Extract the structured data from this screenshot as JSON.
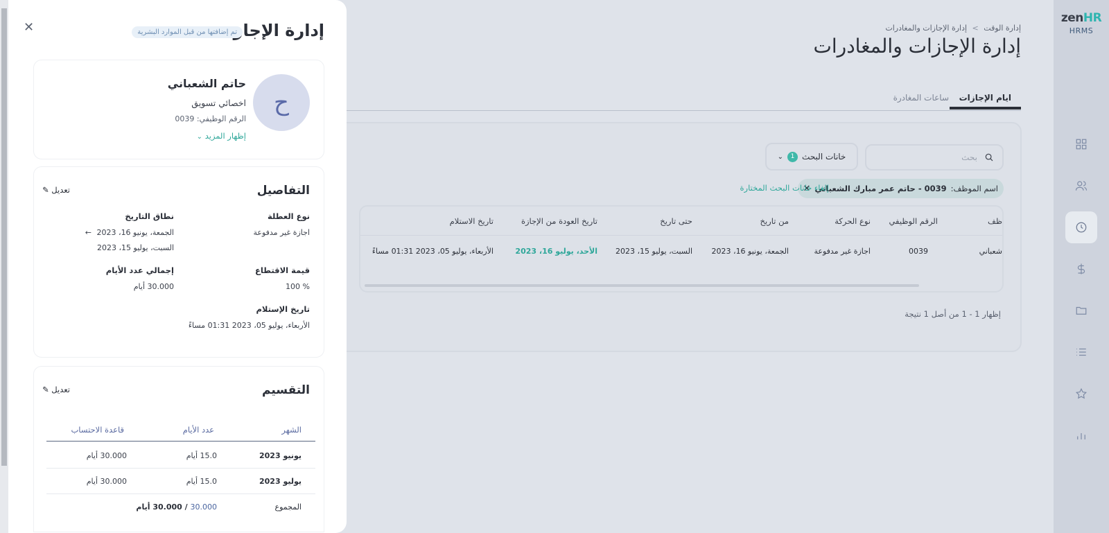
{
  "brand": {
    "logo_a": "zen",
    "logo_b": "HR",
    "sub": "HRMS"
  },
  "sidebar": {
    "items": [
      "dashboard-icon",
      "people-icon",
      "clock-icon",
      "dollar-icon",
      "folder-icon",
      "list-icon",
      "star-icon",
      "chart-icon"
    ],
    "active": "clock-icon"
  },
  "main": {
    "breadcrumb": [
      "إدارة الوقت",
      ">",
      "إدارة الإجازات والمغادرات"
    ],
    "title": "إدارة الإجازات والمغادرات",
    "tabs": [
      {
        "label": "ايام الإجازات",
        "active": true
      },
      {
        "label": "ساعات المغادرة",
        "active": false
      }
    ],
    "search_placeholder": "بحث",
    "fields_button": {
      "label": "خانات البحث",
      "count": "1"
    },
    "chip": {
      "label": "اسم الموظف:",
      "value": "0039 - حاتم عمر مبارك الشعباني"
    },
    "cancel_link": "إلغاء خانات البحث المختارة",
    "table": {
      "headers": [
        "ظف",
        "الرقم الوظيفي",
        "نوع الحركة",
        "من تاريخ",
        "حتى تاريخ",
        "تاريخ العودة من الإجازة",
        "تاريخ الاستلام"
      ],
      "row": [
        "شعباني",
        "0039",
        "اجازة غير مدفوعة",
        "الجمعة، يونيو 16، 2023",
        "السبت، يوليو 15، 2023",
        "الأحد، يوليو 16، 2023",
        "الأربعاء، يوليو 05، 2023 01:31 مساءً"
      ]
    },
    "results_text": "إظهار 1 - 1 من أصل 1 نتيجة"
  },
  "drawer": {
    "title": "إدارة الإجازة",
    "badge": "تم إضافتها من قبل الموارد البشرية",
    "employee": {
      "avatar_letter": "ح",
      "name": "حاتم الشعباني",
      "job": "اخصائي تسويق",
      "id_text": "الرقم الوظيفي: 0039",
      "show_more": "إظهار المزيد"
    },
    "details": {
      "title": "التفاصيل",
      "edit": "تعديل",
      "leave_type_label": "نوع العطلة",
      "leave_type_value": "اجازة غير مدفوعة",
      "date_range_label": "نطاق التاريخ",
      "date_from": "الجمعة، يونيو 16، 2023",
      "date_to": "السبت، يوليو 15، 2023",
      "deduction_label": "قيمة الاقتطاع",
      "deduction_value": "% 100",
      "total_days_label": "إجمالي عدد الأيام",
      "total_days_value": "30.000 أيام",
      "received_label": "تاريخ الإستلام",
      "received_value": "الأربعاء، يوليو 05، 2023 01:31 مساءً"
    },
    "split": {
      "title": "التقسيم",
      "edit": "تعديل",
      "headers": [
        "الشهر",
        "عدد الأيام",
        "قاعدة الاحتساب"
      ],
      "rows": [
        [
          "يونيو 2023",
          "15.0 أيام",
          "30.000 أيام"
        ],
        [
          "يوليو 2023",
          "15.0 أيام",
          "30.000 أيام"
        ]
      ],
      "total_label": "المجموع",
      "total_a": "30.000",
      "total_sep": " / ",
      "total_b": "30.000 أيام"
    },
    "close_icon": "close-icon"
  }
}
